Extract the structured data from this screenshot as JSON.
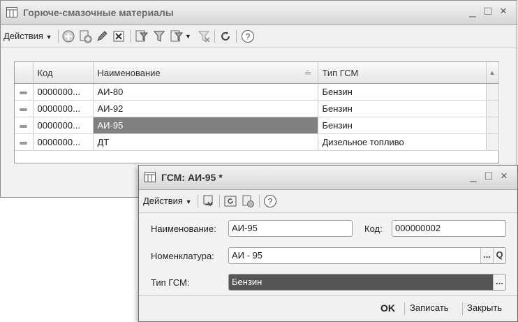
{
  "main_window": {
    "title": "Горюче-смазочные материалы",
    "controls": {
      "minimize": "_",
      "maximize": "□",
      "close": "×"
    },
    "toolbar": {
      "actions_label": "Действия"
    },
    "table": {
      "columns": [
        "Код",
        "Наименование",
        "Тип ГСМ"
      ],
      "sort_indicator": "≐",
      "rows": [
        {
          "code": "0000000...",
          "name": "АИ-80",
          "type": "Бензин"
        },
        {
          "code": "0000000...",
          "name": "АИ-92",
          "type": "Бензин"
        },
        {
          "code": "0000000...",
          "name": "АИ-95",
          "type": "Бензин"
        },
        {
          "code": "0000000...",
          "name": "ДТ",
          "type": "Дизельное топливо"
        }
      ]
    }
  },
  "dialog": {
    "title": "ГСМ: АИ-95 *",
    "controls": {
      "minimize": "_",
      "maximize": "□",
      "close": "×"
    },
    "toolbar": {
      "actions_label": "Действия"
    },
    "fields": {
      "name_label": "Наименование:",
      "name_value": "АИ-95",
      "code_label": "Код:",
      "code_value": "000000002",
      "nomenclature_label": "Номенклатура:",
      "nomenclature_value": "АИ - 95",
      "fuel_type_label": "Тип ГСМ:",
      "fuel_type_value": "Бензин"
    },
    "footer": {
      "ok": "OK",
      "save": "Записать",
      "close": "Закрыть"
    },
    "button_glyphs": {
      "ellipsis": "...",
      "search": "Q"
    }
  }
}
